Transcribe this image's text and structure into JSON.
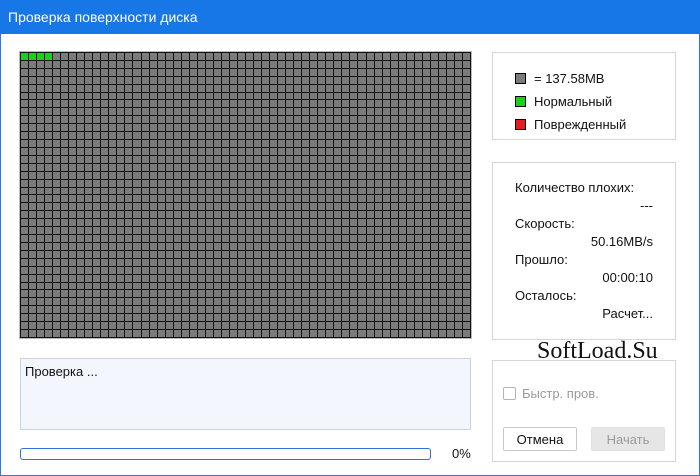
{
  "window": {
    "title": "Проверка поверхности диска"
  },
  "surface_map": {
    "columns": 56,
    "rows": 36,
    "scanned_ok_cells": 4
  },
  "legend": {
    "block_size_label": "= 137.58MB",
    "normal_label": "Нормальный",
    "damaged_label": "Поврежденный",
    "colors": {
      "block": "#7b7b7b",
      "normal": "#19d119",
      "damaged": "#e02020"
    }
  },
  "stats": {
    "bad_label": "Количество плохих:",
    "bad_value": "---",
    "speed_label": "Скорость:",
    "speed_value": "50.16MB/s",
    "elapsed_label": "Прошло:",
    "elapsed_value": "00:00:10",
    "remaining_label": "Осталось:",
    "remaining_value": "Расчет..."
  },
  "log": {
    "text": "Проверка ..."
  },
  "progress": {
    "percent_label": "0%",
    "value": 0
  },
  "controls": {
    "quick_check_label": "Быстр. пров.",
    "quick_check_checked": false,
    "cancel_label": "Отмена",
    "start_label": "Начать"
  },
  "watermark": {
    "text": "SoftLoad.Su"
  }
}
